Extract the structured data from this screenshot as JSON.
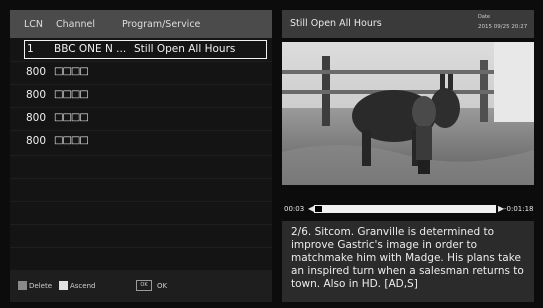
{
  "list": {
    "headers": {
      "lcn": "LCN",
      "channel": "Channel",
      "program": "Program/Service"
    },
    "rows": [
      {
        "lcn": "1",
        "channel": "BBC ONE N ...",
        "program": "Still Open All Hours",
        "selected": true
      },
      {
        "lcn": "800",
        "channel": "□□□□",
        "program": ""
      },
      {
        "lcn": "800",
        "channel": "□□□□",
        "program": ""
      },
      {
        "lcn": "800",
        "channel": "□□□□",
        "program": ""
      },
      {
        "lcn": "800",
        "channel": "□□□□",
        "program": ""
      }
    ],
    "footer": {
      "delete_label": "Delete",
      "delete_color": "#8a8a8a",
      "ascend_label": "Ascend",
      "ascend_color": "#e0e0e0",
      "ok_key": "OK",
      "ok_label": "OK"
    }
  },
  "detail": {
    "title": "Still Open All Hours",
    "date_label": "Date",
    "date_value": "2015 09/25 20:27",
    "elapsed": "00:03",
    "remaining": "-0:01:18",
    "progress": 0.02,
    "description": "2/6. Sitcom. Granville is determined to improve Gastric's image in order to matchmake him with Madge. His plans take an inspired turn when a salesman returns to town. Also in HD. [AD,S]"
  }
}
